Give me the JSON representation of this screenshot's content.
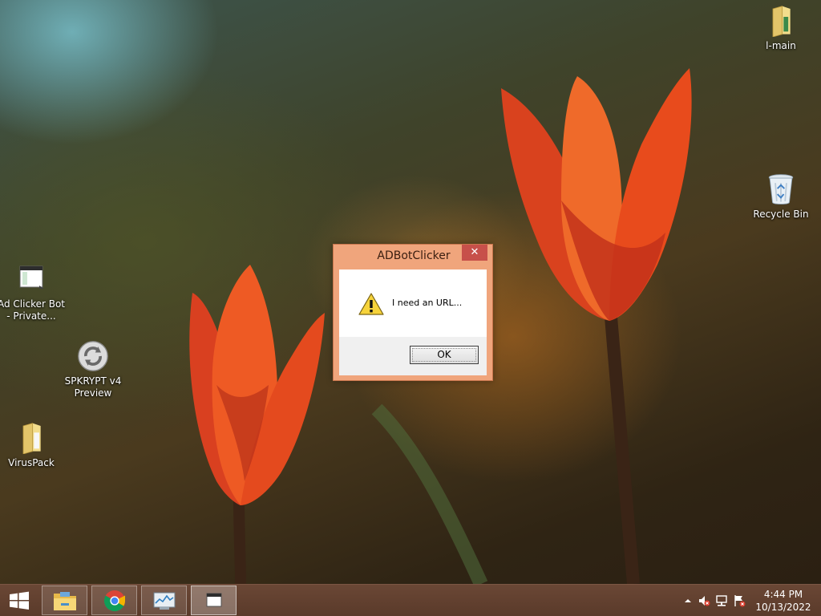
{
  "desktop": {
    "icons": [
      {
        "label": "l-main"
      },
      {
        "label": "Recycle Bin"
      },
      {
        "label": "Ad Clicker Bot - Private..."
      },
      {
        "label": "SPKRYPT v4 Preview"
      },
      {
        "label": "VirusPack"
      }
    ]
  },
  "dialog": {
    "title": "ADBotClicker",
    "close_label": "✕",
    "icon": "warning-icon",
    "message": "I need an URL...",
    "ok_label": "OK"
  },
  "taskbar": {
    "buttons": [
      {
        "icon": "file-explorer-icon"
      },
      {
        "icon": "chrome-icon"
      },
      {
        "icon": "resource-monitor-icon"
      },
      {
        "icon": "window-icon",
        "active": true
      }
    ],
    "tray": {
      "icons": [
        "show-hidden-icons-chevron",
        "speaker-muted-icon",
        "network-icon",
        "action-center-icon"
      ],
      "time": "4:44 PM",
      "date": "10/13/2022"
    }
  },
  "colors": {
    "taskbar": "#5f3f2f",
    "dialog_frame": "#f0a57c",
    "close_button": "#c7504a"
  }
}
